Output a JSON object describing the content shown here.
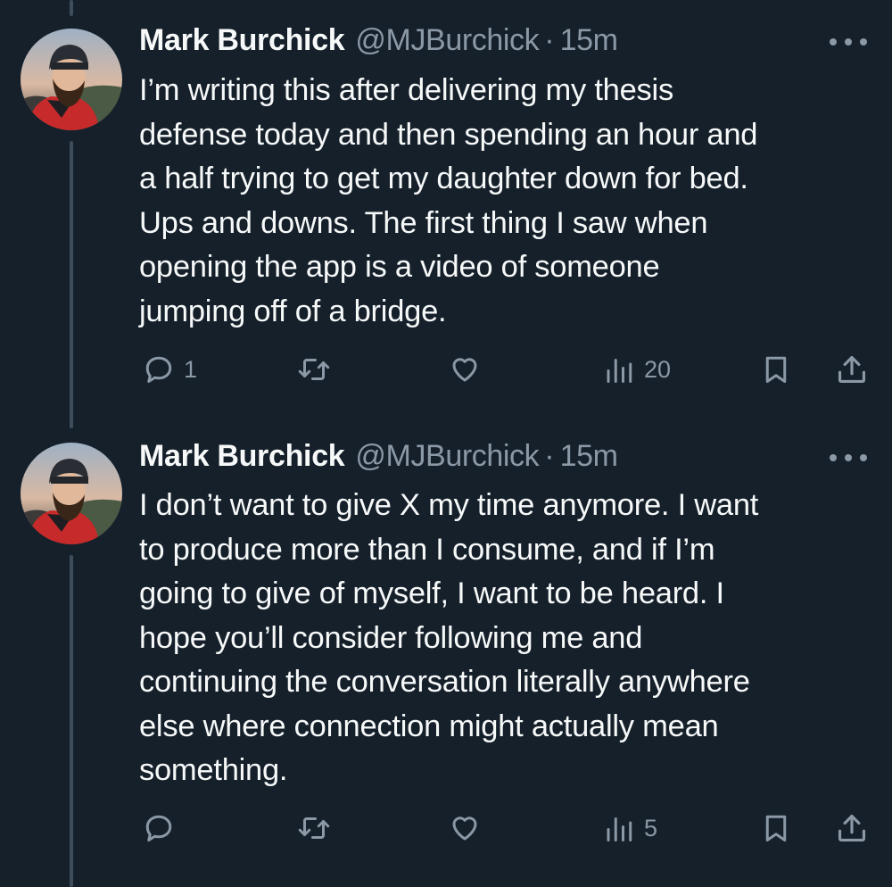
{
  "colors": {
    "background": "#15202b",
    "primary_text": "#f7f9f9",
    "secondary_text": "#8b98a5",
    "thread_line": "#3d4d5c"
  },
  "tweets": [
    {
      "author_name": "Mark Burchick",
      "author_handle": "@MJBurchick",
      "separator": "·",
      "time": "15m",
      "more_icon": "more-horizontal-icon",
      "body_lines": [
        "I’m writing this after delivering my thesis",
        "defense today and then spending an hour and",
        "a half trying to get my daughter down for bed.",
        "Ups and downs. The first thing I saw when",
        "opening the app is a video of someone",
        "jumping off of a bridge."
      ],
      "actions": {
        "reply_count": "1",
        "retweet_count": "",
        "like_count": "",
        "views_count": "20"
      }
    },
    {
      "author_name": "Mark Burchick",
      "author_handle": "@MJBurchick",
      "separator": "·",
      "time": "15m",
      "more_icon": "more-horizontal-icon",
      "body_lines": [
        "I don’t want to give X my time anymore. I want",
        "to produce more than I consume, and if I’m",
        "going to give of myself, I want to be heard. I",
        "hope you’ll consider following me and",
        "continuing the conversation literally anywhere",
        "else where connection might actually mean",
        "something."
      ],
      "actions": {
        "reply_count": "",
        "retweet_count": "",
        "like_count": "",
        "views_count": "5"
      }
    }
  ]
}
